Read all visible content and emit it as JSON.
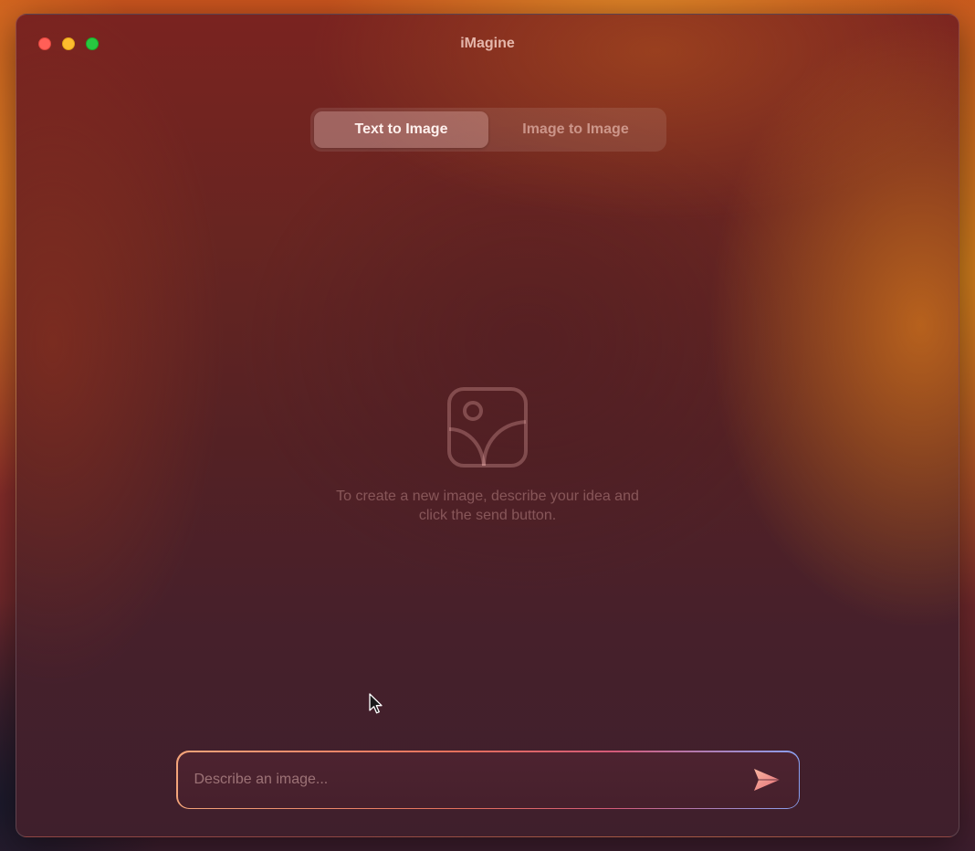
{
  "window": {
    "title": "iMagine"
  },
  "mode_switch": {
    "tabs": [
      {
        "label": "Text to Image",
        "selected": true
      },
      {
        "label": "Image to Image",
        "selected": false
      }
    ]
  },
  "empty_state": {
    "icon": "image-placeholder-icon",
    "message_line1": "To create a new image, describe your idea and",
    "message_line2": "click the send button."
  },
  "prompt": {
    "placeholder": "Describe an image...",
    "value": "",
    "send_icon": "paper-plane-icon"
  },
  "colors": {
    "accent_gradient": [
      "#f4a47a",
      "#e5705c",
      "#d45a78",
      "#8aa0f0"
    ],
    "traffic_close": "#ff5f57",
    "traffic_minimize": "#febc2e",
    "traffic_maximize": "#28c840"
  }
}
